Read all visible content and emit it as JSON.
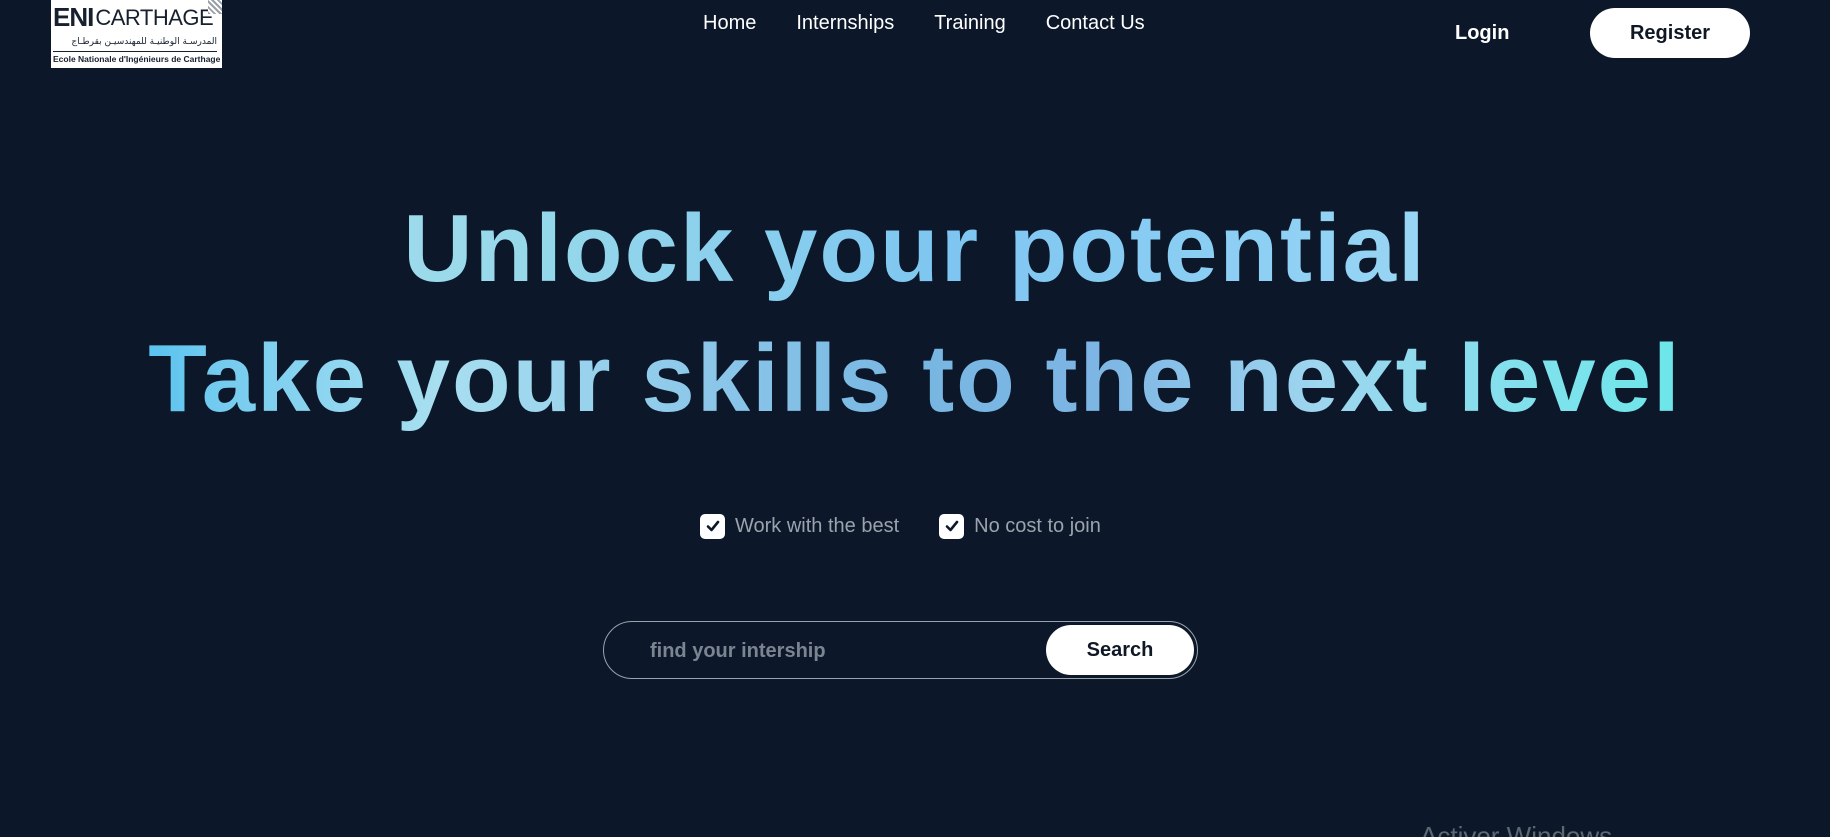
{
  "logo": {
    "brand_prefix": "ENI",
    "brand_name": "CARTHAGE",
    "arabic_name": "المدرسـة الوطنيـة للمهندسيـن بقرطـاج",
    "french_name": "Ecole Nationale d'Ingénieurs de Carthage"
  },
  "nav": {
    "items": [
      {
        "label": "Home"
      },
      {
        "label": "Internships"
      },
      {
        "label": "Training"
      },
      {
        "label": "Contact Us"
      }
    ],
    "login_label": "Login",
    "register_label": "Register"
  },
  "hero": {
    "line1": "Unlock your potential",
    "line2": "Take your skills to the next level"
  },
  "features": [
    {
      "label": "Work with the best",
      "checked": true
    },
    {
      "label": "No cost to join",
      "checked": true
    }
  ],
  "search": {
    "placeholder": "find your intership",
    "value": "",
    "button_label": "Search"
  },
  "watermark": {
    "text": "Activer Windows"
  },
  "colors": {
    "background": "#0c1829",
    "button_bg": "#ffffff",
    "muted_text": "#9aa3ad"
  }
}
